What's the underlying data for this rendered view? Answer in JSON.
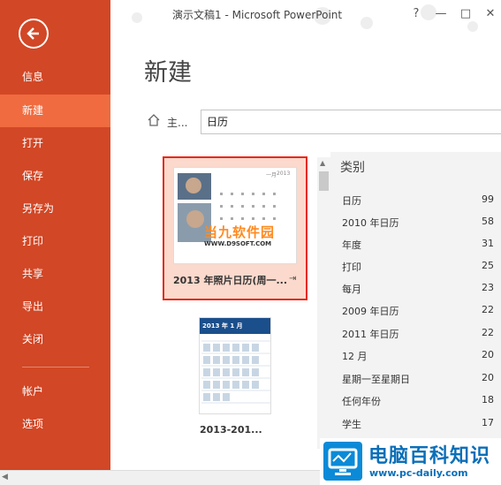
{
  "window": {
    "title": "演示文稿1 - Microsoft PowerPoint",
    "help_label": "?",
    "minimize_label": "—",
    "restore_label": "□",
    "close_label": "✕"
  },
  "sidebar": {
    "items": [
      {
        "label": "信息"
      },
      {
        "label": "新建"
      },
      {
        "label": "打开"
      },
      {
        "label": "保存"
      },
      {
        "label": "另存为"
      },
      {
        "label": "打印"
      },
      {
        "label": "共享"
      },
      {
        "label": "导出"
      },
      {
        "label": "关闭"
      },
      {
        "label": "帐户"
      },
      {
        "label": "选项"
      }
    ]
  },
  "main": {
    "title": "新建",
    "breadcrumb_label": "主...",
    "search_value": "日历"
  },
  "templates": [
    {
      "label": "2013 年照片日历(周一...",
      "month_label": "一月",
      "year_label": "2013"
    },
    {
      "label": "2013-201...",
      "month_label": "2013 年 1 月"
    }
  ],
  "categories": {
    "heading": "类别",
    "items": [
      {
        "name": "日历",
        "count": "99"
      },
      {
        "name": "2010 年日历",
        "count": "58"
      },
      {
        "name": "年度",
        "count": "31"
      },
      {
        "name": "打印",
        "count": "25"
      },
      {
        "name": "每月",
        "count": "23"
      },
      {
        "name": "2009 年日历",
        "count": "22"
      },
      {
        "name": "2011 年日历",
        "count": "22"
      },
      {
        "name": "12 月",
        "count": "20"
      },
      {
        "name": "星期一至星期日",
        "count": "20"
      },
      {
        "name": "任何年份",
        "count": "18"
      },
      {
        "name": "学生",
        "count": "17"
      }
    ]
  },
  "watermarks": {
    "overlay_text": "当九软件园",
    "overlay_url": "WWW.D9SOFT.COM",
    "logo_text": "电脑百科知识",
    "logo_url": "www.pc-daily.com"
  },
  "colors": {
    "sidebar": "#d24726",
    "sidebar_active": "#f06b3f",
    "selected_card": "#fbd9cc",
    "selected_border": "#e8291c"
  }
}
